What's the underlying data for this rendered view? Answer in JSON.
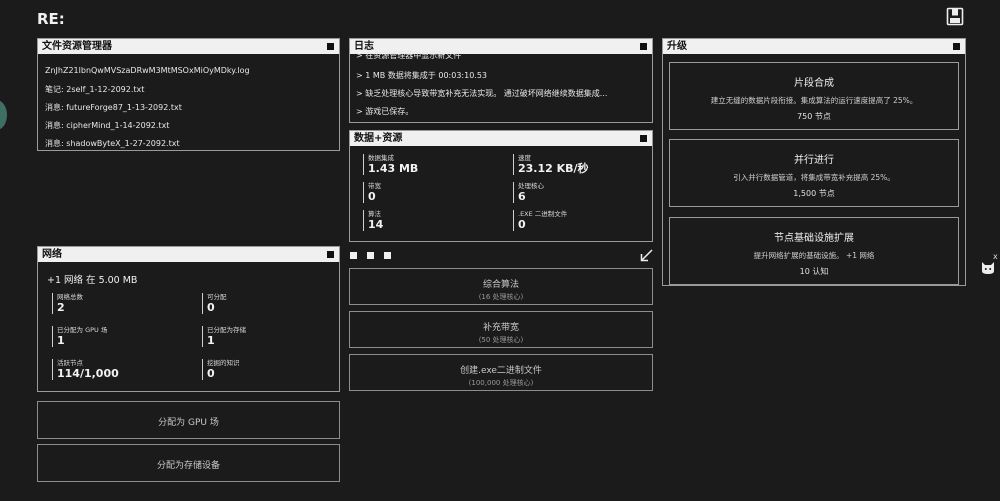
{
  "app": {
    "logo": "RE:"
  },
  "files": {
    "title": "文件资源管理器",
    "items": [
      "ZnJhZ21lbnQwMVSzaDRwM3MtMSOxMiOyMDky.log",
      "笔记: 2self_1-12-2092.txt",
      "消息: futureForge87_1-13-2092.txt",
      "消息: cipherMind_1-14-2092.txt",
      "消息: shadowByteX_1-27-2092.txt"
    ]
  },
  "log": {
    "title": "日志",
    "lines": [
      "> 在资源管理器中显示新文件",
      "> 1 MB 数据将集成于 00:03:10.53",
      "> 缺乏处理核心导致带宽补充无法实现。 通过破坏网络继续数据集成...",
      "> 游戏已保存。"
    ]
  },
  "resources": {
    "title": "数据+资源",
    "stats": [
      {
        "label": "数据集成",
        "value": "1.43 MB"
      },
      {
        "label": "速度",
        "value": "23.12 KB/秒"
      },
      {
        "label": "带宽",
        "value": "0"
      },
      {
        "label": "处理核心",
        "value": "6"
      },
      {
        "label": "算法",
        "value": "14"
      },
      {
        "label": ".EXE 二进制文件",
        "value": "0"
      }
    ]
  },
  "actions": [
    {
      "label": "综合算法",
      "sub": "(16 处理核心)"
    },
    {
      "label": "补充带宽",
      "sub": "(50 处理核心)"
    },
    {
      "label": "创建.exe二进制文件",
      "sub": "(100,000 处理核心)"
    }
  ],
  "network": {
    "title": "网络",
    "headline": "+1 网络 在 5.00 MB",
    "stats": [
      {
        "label": "网络总数",
        "value": "2"
      },
      {
        "label": "可分配",
        "value": "0"
      },
      {
        "label": "已分配为 GPU 场",
        "value": "1"
      },
      {
        "label": "已分配为存储",
        "value": "1"
      },
      {
        "label": "活跃节点",
        "value": "114/1,000"
      },
      {
        "label": "挖掘的知识",
        "value": "0"
      }
    ]
  },
  "allocate": {
    "gpu": "分配为 GPU 场",
    "storage": "分配为存储设备"
  },
  "upgrades": {
    "title": "升级",
    "items": [
      {
        "name": "片段合成",
        "desc": "建立无缝的数据片段衔接。集成算法的运行速度提高了 25%。",
        "cost": "750 节点"
      },
      {
        "name": "并行进行",
        "desc": "引入并行数据管道，将集成带宽补充提高 25%。",
        "cost": "1,500 节点"
      },
      {
        "name": "节点基础设施扩展",
        "desc": "提升网络扩展的基础设施。 +1 网络",
        "cost": "10 认知"
      }
    ]
  },
  "misc": {
    "close_glyph": "x"
  }
}
